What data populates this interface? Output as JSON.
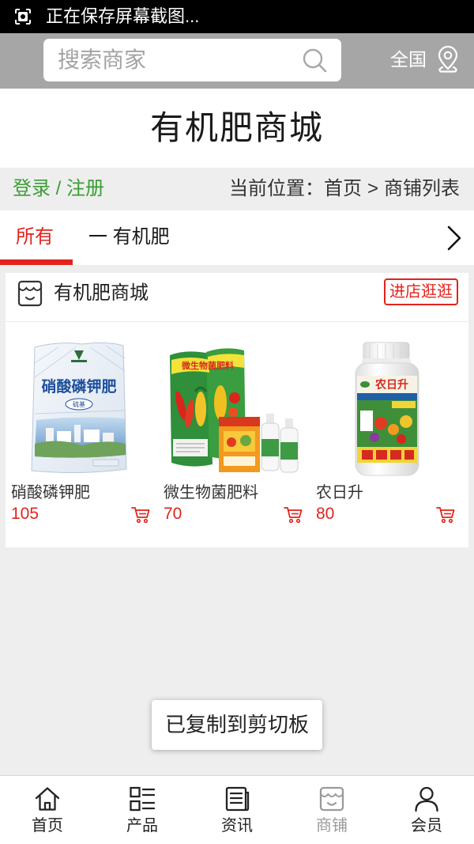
{
  "status_bar": {
    "text": "正在保存屏幕截图...",
    "icon": "screenshot-icon"
  },
  "header": {
    "search_placeholder": "搜索商家",
    "search_icon": "search-icon",
    "region_label": "全国",
    "region_icon": "location-pin-icon"
  },
  "site_title": "有机肥商城",
  "breadcrumb": {
    "auth_label": "登录 / 注册",
    "location_prefix": "当前位置：",
    "home": "首页",
    "separator": ">",
    "current": "商铺列表"
  },
  "tabs": {
    "items": [
      {
        "label": "所有",
        "active": true
      },
      {
        "label": "一 有机肥",
        "active": false
      }
    ],
    "more_icon": "chevron-right-icon"
  },
  "shop": {
    "icon": "store-icon",
    "name": "有机肥商城",
    "enter_button": "进店逛逛",
    "products": [
      {
        "name": "硝酸磷钾肥",
        "price": "105",
        "package_text": [
          "硝酸磷钾肥",
          "硫基"
        ],
        "cart_icon": "cart-icon"
      },
      {
        "name": "微生物菌肥料",
        "price": "70",
        "package_text": [
          "微生物菌肥料"
        ],
        "cart_icon": "cart-icon"
      },
      {
        "name": "农日升",
        "price": "80",
        "package_text": [
          "农日升"
        ],
        "cart_icon": "cart-icon"
      }
    ]
  },
  "toast": "已复制到剪切板",
  "bottom_nav": [
    {
      "label": "首页",
      "icon": "home-icon",
      "active": false
    },
    {
      "label": "产品",
      "icon": "product-list-icon",
      "active": false
    },
    {
      "label": "资讯",
      "icon": "news-icon",
      "active": false
    },
    {
      "label": "商铺",
      "icon": "store-icon",
      "active": true
    },
    {
      "label": "会员",
      "icon": "member-icon",
      "active": false
    }
  ],
  "colors": {
    "accent_red": "#e3231b",
    "link_green": "#3a9e34",
    "header_bg": "#a6a6a6",
    "page_bg": "#eeeeee",
    "nav_current": "#9a9a9a"
  }
}
